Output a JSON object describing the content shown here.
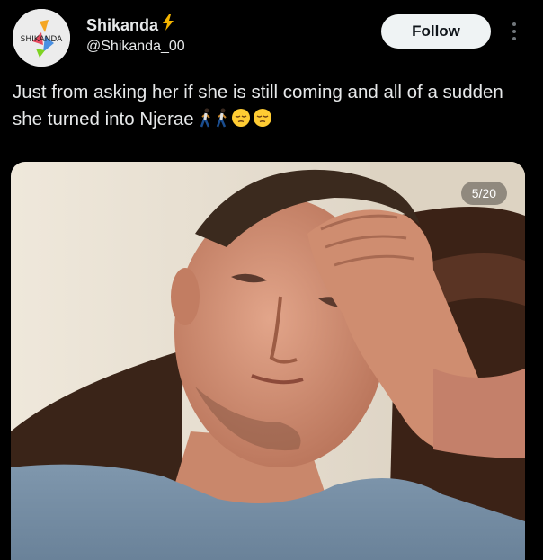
{
  "author": {
    "display_name": "Shikanda",
    "handle": "@Shikanda_00",
    "avatar_text": "SHIKANDA",
    "badge_icon": "lightning-icon"
  },
  "actions": {
    "follow_label": "Follow",
    "more_icon": "more-vertical-icon"
  },
  "post": {
    "text": "Just from asking her if she is still coming and all of a sudden she turned into Njerae",
    "emojis": [
      "person-walking-emoji",
      "person-walking-emoji",
      "pensive-face-emoji",
      "pensive-face-emoji"
    ]
  },
  "media": {
    "counter": "5/20",
    "description_icon": "photo"
  },
  "colors": {
    "background": "#000000",
    "text": "#e7e9ea",
    "follow_bg": "#eff3f4",
    "lightning": "#f4b400"
  }
}
